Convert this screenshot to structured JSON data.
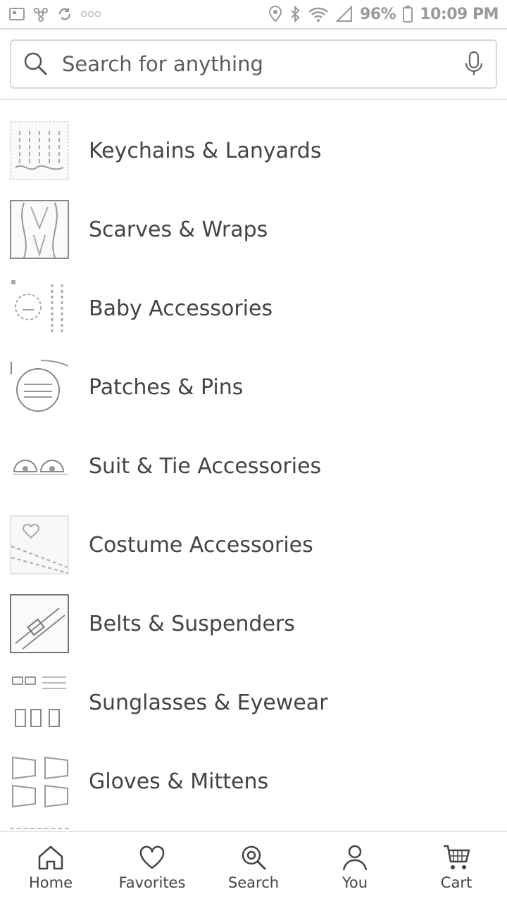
{
  "status_bar": {
    "icons_left": [
      "notification-icon",
      "settings-pinwheel-icon",
      "sync-icon",
      "more-dots-icon"
    ],
    "icons_right": [
      "location-icon",
      "bluetooth-icon",
      "wifi-icon",
      "signal-icon"
    ],
    "battery": "96%",
    "time": "10:09 PM"
  },
  "search": {
    "placeholder": "Search for anything",
    "value": ""
  },
  "categories": [
    {
      "label": "Keychains & Lanyards"
    },
    {
      "label": "Scarves & Wraps"
    },
    {
      "label": "Baby Accessories"
    },
    {
      "label": "Patches & Pins"
    },
    {
      "label": "Suit & Tie Accessories"
    },
    {
      "label": "Costume Accessories"
    },
    {
      "label": "Belts & Suspenders"
    },
    {
      "label": "Sunglasses & Eyewear"
    },
    {
      "label": "Gloves & Mittens"
    }
  ],
  "bottom_nav": {
    "home": "Home",
    "favorites": "Favorites",
    "search": "Search",
    "you": "You",
    "cart": "Cart"
  }
}
